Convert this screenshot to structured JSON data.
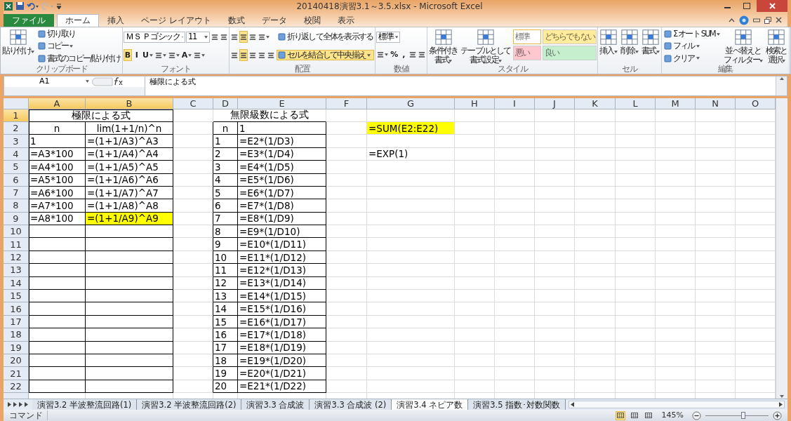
{
  "window": {
    "title": "20140418演習3.1～3.5.xlsx - Microsoft Excel"
  },
  "ribbon": {
    "tabs": [
      {
        "label": "ファイル",
        "kind": "file",
        "selected": false
      },
      {
        "label": "ホーム",
        "kind": "tab",
        "selected": true
      },
      {
        "label": "挿入",
        "kind": "tab",
        "selected": false
      },
      {
        "label": "ページ レイアウト",
        "kind": "tab",
        "selected": false
      },
      {
        "label": "数式",
        "kind": "tab",
        "selected": false
      },
      {
        "label": "データ",
        "kind": "tab",
        "selected": false
      },
      {
        "label": "校閲",
        "kind": "tab",
        "selected": false
      },
      {
        "label": "表示",
        "kind": "tab",
        "selected": false
      }
    ],
    "groups": [
      {
        "label": "クリップボード",
        "items": [
          {
            "kind": "large",
            "lines": [
              "貼り付け"
            ],
            "caret": true
          },
          {
            "kind": "column",
            "buttons": [
              {
                "kind": "button",
                "label": "切り取り",
                "caret": false
              },
              {
                "kind": "button",
                "label": "コピー",
                "caret": true
              },
              {
                "kind": "button",
                "label": "書式のコピー/貼り付け",
                "caret": false
              }
            ]
          }
        ]
      },
      {
        "label": "フォント",
        "items": [
          {
            "kind": "pair",
            "upper": [
              {
                "kind": "combo",
                "value": "ＭＳ Ｐゴシック"
              },
              {
                "kind": "combo",
                "value": "11"
              },
              {
                "kind": "icon",
                "selected": false,
                "caret": false
              },
              {
                "kind": "icon",
                "selected": false,
                "caret": false
              }
            ],
            "lower": [
              {
                "kind": "toggle",
                "label": "B",
                "selected": true,
                "caret": false
              },
              {
                "kind": "toggle",
                "label": "I",
                "selected": false,
                "caret": false
              },
              {
                "kind": "toggle",
                "label": "U",
                "selected": false,
                "caret": true
              },
              {
                "kind": "icon",
                "selected": false,
                "caret": true
              },
              {
                "kind": "icon",
                "selected": false,
                "caret": true
              },
              {
                "kind": "toggle",
                "label": "A",
                "selected": false,
                "caret": true
              },
              {
                "kind": "icon",
                "selected": false,
                "caret": true
              }
            ]
          }
        ]
      },
      {
        "label": "配置",
        "items": [
          {
            "kind": "pair",
            "upper": [
              {
                "kind": "icon",
                "selected": false,
                "caret": false
              },
              {
                "kind": "icon",
                "selected": true,
                "caret": false
              },
              {
                "kind": "icon",
                "selected": false,
                "caret": false
              },
              {
                "kind": "icon",
                "selected": false,
                "caret": true
              }
            ],
            "lower": [
              {
                "kind": "icon",
                "selected": false,
                "caret": false
              },
              {
                "kind": "icon",
                "selected": true,
                "caret": false
              },
              {
                "kind": "icon",
                "selected": false,
                "caret": false
              },
              {
                "kind": "icon",
                "selected": false,
                "caret": false
              },
              {
                "kind": "icon",
                "selected": false,
                "caret": false
              }
            ]
          },
          {
            "kind": "column",
            "buttons": [
              {
                "kind": "button",
                "label": "折り返して全体を表示する",
                "selected": false,
                "caret": false
              },
              {
                "kind": "button",
                "label": "セルを結合して中央揃え",
                "selected": true,
                "caret": true
              }
            ]
          }
        ]
      },
      {
        "label": "数値",
        "items": [
          {
            "kind": "pair",
            "upper": [
              {
                "kind": "combo",
                "value": "標準"
              }
            ],
            "lower": [
              {
                "kind": "icon",
                "selected": false,
                "caret": true
              },
              {
                "kind": "toggle",
                "label": "%",
                "selected": false,
                "caret": false
              },
              {
                "kind": "toggle",
                "label": ",",
                "selected": false,
                "caret": false
              },
              {
                "kind": "icon",
                "selected": false,
                "caret": false
              },
              {
                "kind": "icon",
                "selected": false,
                "caret": false
              }
            ]
          }
        ]
      },
      {
        "label": "スタイル",
        "items": [
          {
            "kind": "large",
            "lines": [
              "条件付き",
              "書式"
            ],
            "caret": true
          },
          {
            "kind": "large",
            "lines": [
              "テーブルとして",
              "書式設定"
            ],
            "caret": true
          },
          {
            "kind": "styles",
            "cells": [
              {
                "label": "標準",
                "color": "#ffffff",
                "selected": true
              },
              {
                "label": "どちらでもない",
                "color": "#ffeb9c",
                "selected": false
              },
              {
                "label": "悪い",
                "color": "#ffc7ce",
                "selected": false
              },
              {
                "label": "良い",
                "color": "#c6efce",
                "selected": false
              }
            ]
          }
        ]
      },
      {
        "label": "セル",
        "items": [
          {
            "kind": "large",
            "lines": [
              "挿入"
            ],
            "caret": true
          },
          {
            "kind": "large",
            "lines": [
              "削除"
            ],
            "caret": true
          },
          {
            "kind": "large",
            "lines": [
              "書式"
            ],
            "caret": true
          }
        ]
      },
      {
        "label": "編集",
        "items": [
          {
            "kind": "column",
            "buttons": [
              {
                "kind": "button",
                "label": "Σ オート SUM",
                "caret": true
              },
              {
                "kind": "button",
                "label": "フィル",
                "caret": true
              },
              {
                "kind": "button",
                "label": "クリア",
                "caret": true
              }
            ]
          },
          {
            "kind": "large",
            "lines": [
              "並べ替えと",
              "フィルター"
            ],
            "caret": true
          },
          {
            "kind": "large",
            "lines": [
              "検索と",
              "選択"
            ],
            "caret": true
          }
        ]
      }
    ]
  },
  "formula_bar": {
    "name_box": "A1",
    "content": "極限による式"
  },
  "sheet": {
    "columns": [
      {
        "label": "A",
        "selected": true
      },
      {
        "label": "B",
        "selected": true
      },
      {
        "label": "C",
        "selected": false
      },
      {
        "label": "D",
        "selected": false
      },
      {
        "label": "E",
        "selected": false
      },
      {
        "label": "F",
        "selected": false
      },
      {
        "label": "G",
        "selected": false
      },
      {
        "label": "H",
        "selected": false
      },
      {
        "label": "I",
        "selected": false
      },
      {
        "label": "J",
        "selected": false
      },
      {
        "label": "K",
        "selected": false
      },
      {
        "label": "L",
        "selected": false
      },
      {
        "label": "M",
        "selected": false
      },
      {
        "label": "N",
        "selected": false
      },
      {
        "label": "O",
        "selected": false
      }
    ],
    "rows": [
      {
        "label": "1",
        "selected": true,
        "cells": [
          {
            "merged": true
          },
          {
            "text": "極限による式",
            "kind": "title",
            "boxed": true,
            "highlighted": false
          },
          {
            "boxed": false
          },
          {
            "merged": true
          },
          {
            "text": "無限級数による式",
            "kind": "title",
            "boxed": false,
            "highlighted": false
          }
        ]
      },
      {
        "label": "2",
        "selected": false,
        "cells": [
          {
            "text": "n",
            "kind": "header",
            "boxed": true,
            "highlighted": false
          },
          {
            "text": "lim(1+1/n)^n",
            "kind": "header",
            "boxed": true,
            "highlighted": false
          },
          {
            "boxed": false
          },
          {
            "text": "n",
            "kind": "header",
            "boxed": true,
            "highlighted": false
          },
          {
            "text": "1",
            "kind": "value",
            "boxed": true,
            "highlighted": false
          },
          {
            "boxed": false
          },
          {
            "text": "=SUM(E2:E22)",
            "kind": "value",
            "boxed": false,
            "highlighted": true
          }
        ]
      },
      {
        "label": "3",
        "selected": false,
        "cells": [
          {
            "text": "1",
            "kind": "value",
            "boxed": true,
            "highlighted": false
          },
          {
            "text": "=(1+1/A3)^A3",
            "kind": "value",
            "boxed": true,
            "highlighted": false
          },
          {
            "boxed": false
          },
          {
            "text": "1",
            "kind": "value",
            "boxed": true,
            "highlighted": false
          },
          {
            "text": "=E2*(1/D3)",
            "kind": "value",
            "boxed": true,
            "highlighted": false
          }
        ]
      },
      {
        "label": "4",
        "selected": false,
        "cells": [
          {
            "text": "=A3*100",
            "kind": "value",
            "boxed": true,
            "highlighted": false
          },
          {
            "text": "=(1+1/A4)^A4",
            "kind": "value",
            "boxed": true,
            "highlighted": false
          },
          {
            "boxed": false
          },
          {
            "text": "2",
            "kind": "value",
            "boxed": true,
            "highlighted": false
          },
          {
            "text": "=E3*(1/D4)",
            "kind": "value",
            "boxed": true,
            "highlighted": false
          },
          {
            "boxed": false
          },
          {
            "text": "=EXP(1)",
            "kind": "value",
            "boxed": false,
            "highlighted": false
          }
        ]
      },
      {
        "label": "5",
        "selected": false,
        "cells": [
          {
            "text": "=A4*100",
            "kind": "value",
            "boxed": true,
            "highlighted": false
          },
          {
            "text": "=(1+1/A5)^A5",
            "kind": "value",
            "boxed": true,
            "highlighted": false
          },
          {
            "boxed": false
          },
          {
            "text": "3",
            "kind": "value",
            "boxed": true,
            "highlighted": false
          },
          {
            "text": "=E4*(1/D5)",
            "kind": "value",
            "boxed": true,
            "highlighted": false
          }
        ]
      },
      {
        "label": "6",
        "selected": false,
        "cells": [
          {
            "text": "=A5*100",
            "kind": "value",
            "boxed": true,
            "highlighted": false
          },
          {
            "text": "=(1+1/A6)^A6",
            "kind": "value",
            "boxed": true,
            "highlighted": false
          },
          {
            "boxed": false
          },
          {
            "text": "4",
            "kind": "value",
            "boxed": true,
            "highlighted": false
          },
          {
            "text": "=E5*(1/D6)",
            "kind": "value",
            "boxed": true,
            "highlighted": false
          }
        ]
      },
      {
        "label": "7",
        "selected": false,
        "cells": [
          {
            "text": "=A6*100",
            "kind": "value",
            "boxed": true,
            "highlighted": false
          },
          {
            "text": "=(1+1/A7)^A7",
            "kind": "value",
            "boxed": true,
            "highlighted": false
          },
          {
            "boxed": false
          },
          {
            "text": "5",
            "kind": "value",
            "boxed": true,
            "highlighted": false
          },
          {
            "text": "=E6*(1/D7)",
            "kind": "value",
            "boxed": true,
            "highlighted": false
          }
        ]
      },
      {
        "label": "8",
        "selected": false,
        "cells": [
          {
            "text": "=A7*100",
            "kind": "value",
            "boxed": true,
            "highlighted": false
          },
          {
            "text": "=(1+1/A8)^A8",
            "kind": "value",
            "boxed": true,
            "highlighted": false
          },
          {
            "boxed": false
          },
          {
            "text": "6",
            "kind": "value",
            "boxed": true,
            "highlighted": false
          },
          {
            "text": "=E7*(1/D8)",
            "kind": "value",
            "boxed": true,
            "highlighted": false
          }
        ]
      },
      {
        "label": "9",
        "selected": false,
        "cells": [
          {
            "text": "=A8*100",
            "kind": "value",
            "boxed": true,
            "highlighted": false
          },
          {
            "text": "=(1+1/A9)^A9",
            "kind": "value",
            "boxed": true,
            "highlighted": true
          },
          {
            "boxed": false
          },
          {
            "text": "7",
            "kind": "value",
            "boxed": true,
            "highlighted": false
          },
          {
            "text": "=E8*(1/D9)",
            "kind": "value",
            "boxed": true,
            "highlighted": false
          }
        ]
      },
      {
        "label": "10",
        "selected": false,
        "cells": [
          {
            "boxed": true
          },
          {
            "boxed": true
          },
          {
            "boxed": false
          },
          {
            "text": "8",
            "kind": "value",
            "boxed": true,
            "highlighted": false
          },
          {
            "text": "=E9*(1/D10)",
            "kind": "value",
            "boxed": true,
            "highlighted": false
          }
        ]
      },
      {
        "label": "11",
        "selected": false,
        "cells": [
          {
            "boxed": true
          },
          {
            "boxed": true
          },
          {
            "boxed": false
          },
          {
            "text": "9",
            "kind": "value",
            "boxed": true,
            "highlighted": false
          },
          {
            "text": "=E10*(1/D11)",
            "kind": "value",
            "boxed": true,
            "highlighted": false
          }
        ]
      },
      {
        "label": "12",
        "selected": false,
        "cells": [
          {
            "boxed": true
          },
          {
            "boxed": true
          },
          {
            "boxed": false
          },
          {
            "text": "10",
            "kind": "value",
            "boxed": true,
            "highlighted": false
          },
          {
            "text": "=E11*(1/D12)",
            "kind": "value",
            "boxed": true,
            "highlighted": false
          }
        ]
      },
      {
        "label": "13",
        "selected": false,
        "cells": [
          {
            "boxed": true
          },
          {
            "boxed": true
          },
          {
            "boxed": false
          },
          {
            "text": "11",
            "kind": "value",
            "boxed": true,
            "highlighted": false
          },
          {
            "text": "=E12*(1/D13)",
            "kind": "value",
            "boxed": true,
            "highlighted": false
          }
        ]
      },
      {
        "label": "14",
        "selected": false,
        "cells": [
          {
            "boxed": true
          },
          {
            "boxed": true
          },
          {
            "boxed": false
          },
          {
            "text": "12",
            "kind": "value",
            "boxed": true,
            "highlighted": false
          },
          {
            "text": "=E13*(1/D14)",
            "kind": "value",
            "boxed": true,
            "highlighted": false
          }
        ]
      },
      {
        "label": "15",
        "selected": false,
        "cells": [
          {
            "boxed": true
          },
          {
            "boxed": true
          },
          {
            "boxed": false
          },
          {
            "text": "13",
            "kind": "value",
            "boxed": true,
            "highlighted": false
          },
          {
            "text": "=E14*(1/D15)",
            "kind": "value",
            "boxed": true,
            "highlighted": false
          }
        ]
      },
      {
        "label": "16",
        "selected": false,
        "cells": [
          {
            "boxed": true
          },
          {
            "boxed": true
          },
          {
            "boxed": false
          },
          {
            "text": "14",
            "kind": "value",
            "boxed": true,
            "highlighted": false
          },
          {
            "text": "=E15*(1/D16)",
            "kind": "value",
            "boxed": true,
            "highlighted": false
          }
        ]
      },
      {
        "label": "17",
        "selected": false,
        "cells": [
          {
            "boxed": true
          },
          {
            "boxed": true
          },
          {
            "boxed": false
          },
          {
            "text": "15",
            "kind": "value",
            "boxed": true,
            "highlighted": false
          },
          {
            "text": "=E16*(1/D17)",
            "kind": "value",
            "boxed": true,
            "highlighted": false
          }
        ]
      },
      {
        "label": "18",
        "selected": false,
        "cells": [
          {
            "boxed": true
          },
          {
            "boxed": true
          },
          {
            "boxed": false
          },
          {
            "text": "16",
            "kind": "value",
            "boxed": true,
            "highlighted": false
          },
          {
            "text": "=E17*(1/D18)",
            "kind": "value",
            "boxed": true,
            "highlighted": false
          }
        ]
      },
      {
        "label": "19",
        "selected": false,
        "cells": [
          {
            "boxed": true
          },
          {
            "boxed": true
          },
          {
            "boxed": false
          },
          {
            "text": "17",
            "kind": "value",
            "boxed": true,
            "highlighted": false
          },
          {
            "text": "=E18*(1/D19)",
            "kind": "value",
            "boxed": true,
            "highlighted": false
          }
        ]
      },
      {
        "label": "20",
        "selected": false,
        "cells": [
          {
            "boxed": true
          },
          {
            "boxed": true
          },
          {
            "boxed": false
          },
          {
            "text": "18",
            "kind": "value",
            "boxed": true,
            "highlighted": false
          },
          {
            "text": "=E19*(1/D20)",
            "kind": "value",
            "boxed": true,
            "highlighted": false
          }
        ]
      },
      {
        "label": "21",
        "selected": false,
        "cells": [
          {
            "boxed": true
          },
          {
            "boxed": true
          },
          {
            "boxed": false
          },
          {
            "text": "19",
            "kind": "value",
            "boxed": true,
            "highlighted": false
          },
          {
            "text": "=E20*(1/D21)",
            "kind": "value",
            "boxed": true,
            "highlighted": false
          }
        ]
      },
      {
        "label": "22",
        "selected": false,
        "cells": [
          {
            "boxed": true
          },
          {
            "boxed": true
          },
          {
            "boxed": false
          },
          {
            "text": "20",
            "kind": "value",
            "boxed": true,
            "highlighted": false
          },
          {
            "text": "=E21*(1/D22)",
            "kind": "value",
            "boxed": true,
            "highlighted": false
          }
        ]
      }
    ]
  },
  "sheet_tabs": [
    {
      "label": "演習3.2 半波整流回路(1)",
      "selected": false
    },
    {
      "label": "演習3.2 半波整流回路(2)",
      "selected": false
    },
    {
      "label": "演習3.3 合成波",
      "selected": false
    },
    {
      "label": "演習3.3 合成波 (2)",
      "selected": false
    },
    {
      "label": "演習3.4 ネピア数",
      "selected": true
    },
    {
      "label": "演習3.5 指数･対数関数",
      "selected": false
    }
  ],
  "status_bar": {
    "mode": "コマンド",
    "views": [
      {
        "selected": true
      },
      {
        "selected": false
      },
      {
        "selected": false
      }
    ],
    "zoom": "145%",
    "zoom_slider": {
      "level": 0.6
    }
  }
}
